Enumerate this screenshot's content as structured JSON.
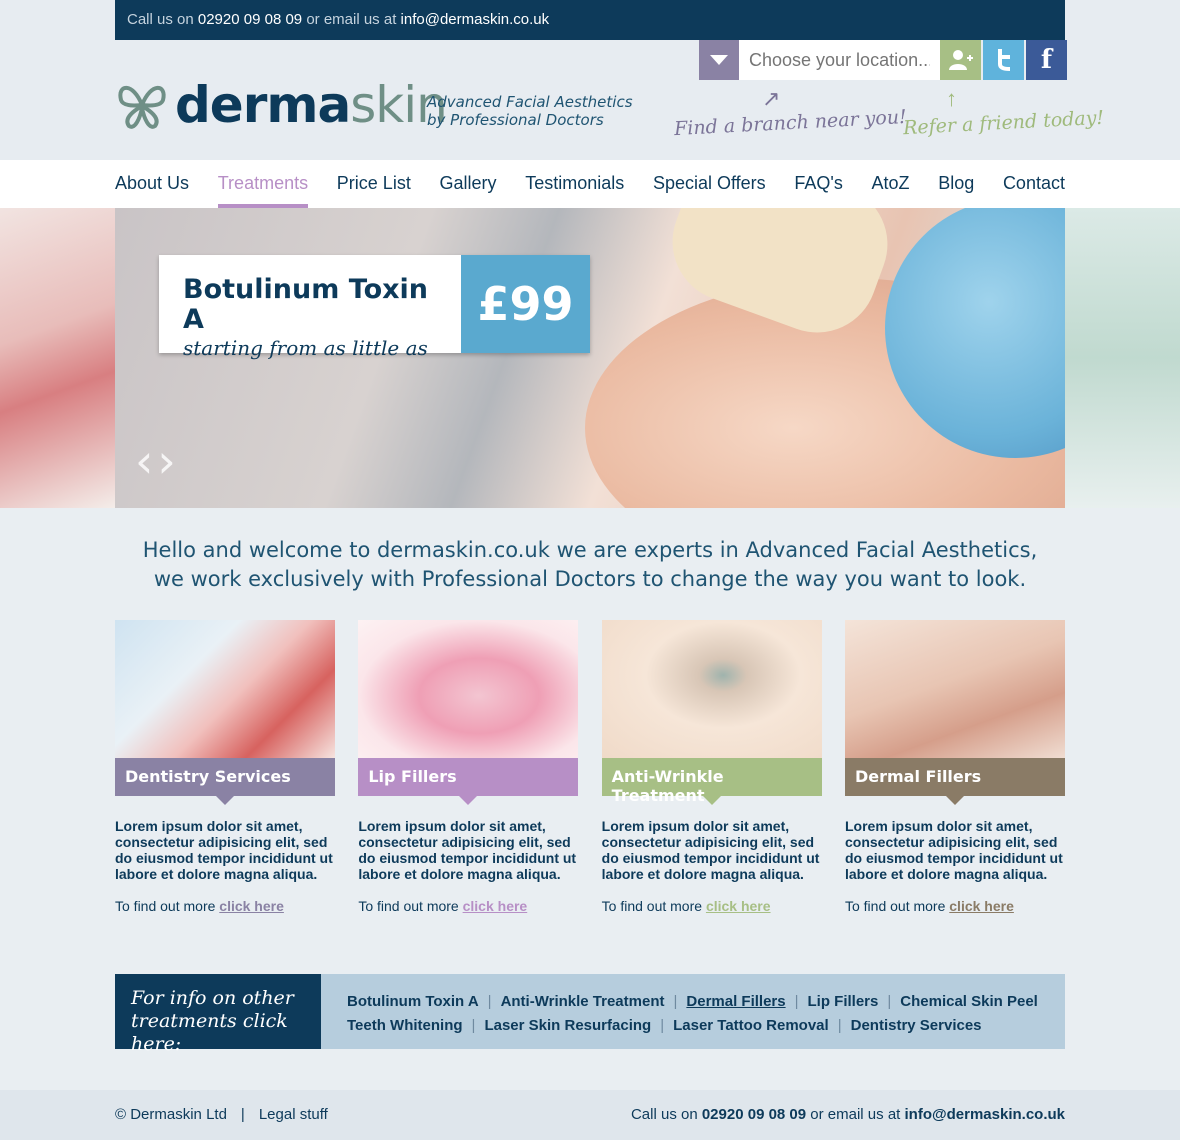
{
  "topbar": {
    "call_prefix": "Call us on ",
    "phone": "02920 09 08 09",
    "email_prefix": " or email us at ",
    "email": "info@dermaskin.co.uk"
  },
  "brand": {
    "logo_dark": "derma",
    "logo_light": "skin",
    "tagline_line1": "Advanced Facial Aesthetics",
    "tagline_line2": "by Professional Doctors"
  },
  "location": {
    "placeholder": "Choose your location..."
  },
  "hints": {
    "branch": "Find a branch near you!",
    "friend": "Refer a friend today!"
  },
  "nav": {
    "items": [
      {
        "label": "About Us"
      },
      {
        "label": "Treatments",
        "active": true
      },
      {
        "label": "Price List"
      },
      {
        "label": "Gallery"
      },
      {
        "label": "Testimonials"
      },
      {
        "label": "Special Offers"
      },
      {
        "label": "FAQ's"
      },
      {
        "label": "AtoZ"
      },
      {
        "label": "Blog"
      },
      {
        "label": "Contact"
      }
    ]
  },
  "hero": {
    "promo_title": "Botulinum Toxin A",
    "promo_sub": "starting from as little as",
    "promo_price": "£99",
    "prev": "‹",
    "next": "›"
  },
  "welcome": {
    "line1": "Hello and welcome to dermaskin.co.uk we are experts in Advanced Facial Aesthetics,",
    "line2": "we work exclusively with Professional Doctors to change the way you want to look."
  },
  "cards": [
    {
      "title": "Dentistry Services",
      "body": "Lorem ipsum dolor sit amet, consectetur adipisicing elit, sed do eiusmod tempor incididunt ut labore et dolore magna aliqua.",
      "more_prefix": "To find out more ",
      "more_link": "click here",
      "link_color": "#8a82a4"
    },
    {
      "title": "Lip Fillers",
      "body": "Lorem ipsum dolor sit amet, consectetur adipisicing elit, sed do eiusmod tempor incididunt ut labore et dolore magna aliqua.",
      "more_prefix": "To find out more ",
      "more_link": "click here",
      "link_color": "#b78fc6"
    },
    {
      "title": "Anti-Wrinkle Treatment",
      "body": "Lorem ipsum dolor sit amet, consectetur adipisicing elit, sed do eiusmod tempor incididunt ut labore et dolore magna aliqua.",
      "more_prefix": "To find out more ",
      "more_link": "click here",
      "link_color": "#a7bf85"
    },
    {
      "title": "Dermal Fillers",
      "body": "Lorem ipsum dolor sit amet, consectetur adipisicing elit, sed do eiusmod tempor incididunt ut labore et dolore magna aliqua.",
      "more_prefix": "To find out more ",
      "more_link": "click here",
      "link_color": "#8a7b66"
    }
  ],
  "strip": {
    "label_line1": "For info on other",
    "label_line2": "treatments click here:",
    "row1": [
      "Botulinum Toxin A",
      "Anti-Wrinkle Treatment",
      "Dermal Fillers",
      "Lip Fillers",
      "Chemical Skin Peel"
    ],
    "row2": [
      "Teeth Whitening",
      "Laser Skin Resurfacing",
      "Laser Tattoo Removal",
      "Dentistry Services"
    ]
  },
  "footer": {
    "copyright": "© Dermaskin Ltd",
    "legal": "Legal stuff",
    "call_prefix": "Call us on ",
    "phone": "02920 09 08 09",
    "email_prefix": " or email us at ",
    "email": "info@dermaskin.co.uk"
  },
  "colors": {
    "navy": "#0d3a5a",
    "purple": "#8a82a4",
    "lilac": "#b78fc6",
    "green": "#a7bf85",
    "brown": "#8a7b66",
    "blue": "#5aa9cf"
  },
  "icons": {
    "dropdown": "triangle-down-icon",
    "add_friend": "add-user-icon",
    "twitter": "twitter-icon",
    "facebook": "facebook-icon",
    "logo": "butterfly-logo-icon"
  }
}
